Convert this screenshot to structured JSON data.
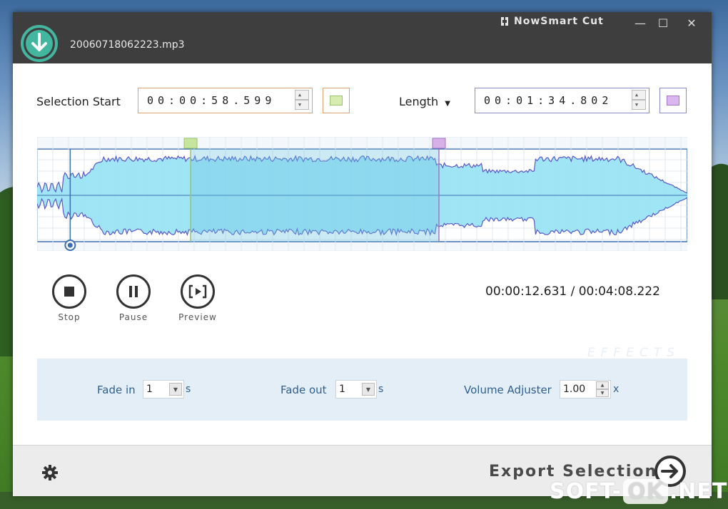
{
  "window": {
    "app_title": "NowSmart Cut",
    "file_name": "20060718062223.mp3",
    "controls": {
      "minimize": "—",
      "maximize": "☐",
      "close": "✕"
    }
  },
  "selection": {
    "start_label": "Selection Start",
    "start_value": "00:00:58.599",
    "length_label": "Length",
    "length_value": "00:01:34.802",
    "start_color": "#c6e6a0",
    "end_color": "#d6b0e6"
  },
  "waveform": {
    "total_seconds": 248.222,
    "playhead_seconds": 12.631,
    "selection_start_seconds": 58.599,
    "selection_end_seconds": 153.401,
    "fill_color": "#8fe0f4",
    "line_color": "#5a58c8",
    "selection_color": "#6cc3df"
  },
  "playback": {
    "stop_label": "Stop",
    "pause_label": "Pause",
    "preview_label": "Preview",
    "time_readout": "00:00:12.631 / 00:04:08.222"
  },
  "effects": {
    "watermark": "EFFECTS",
    "fade_in_label": "Fade in",
    "fade_in_value": "1",
    "fade_out_label": "Fade out",
    "fade_out_value": "1",
    "volume_label": "Volume Adjuster",
    "volume_value": "1.00",
    "seconds_unit": "s",
    "multiplier_unit": "x"
  },
  "footer": {
    "export_label": "Export Selection"
  },
  "watermark": {
    "left": "SOFT-",
    "mid": "OK",
    "right": ".NET"
  }
}
